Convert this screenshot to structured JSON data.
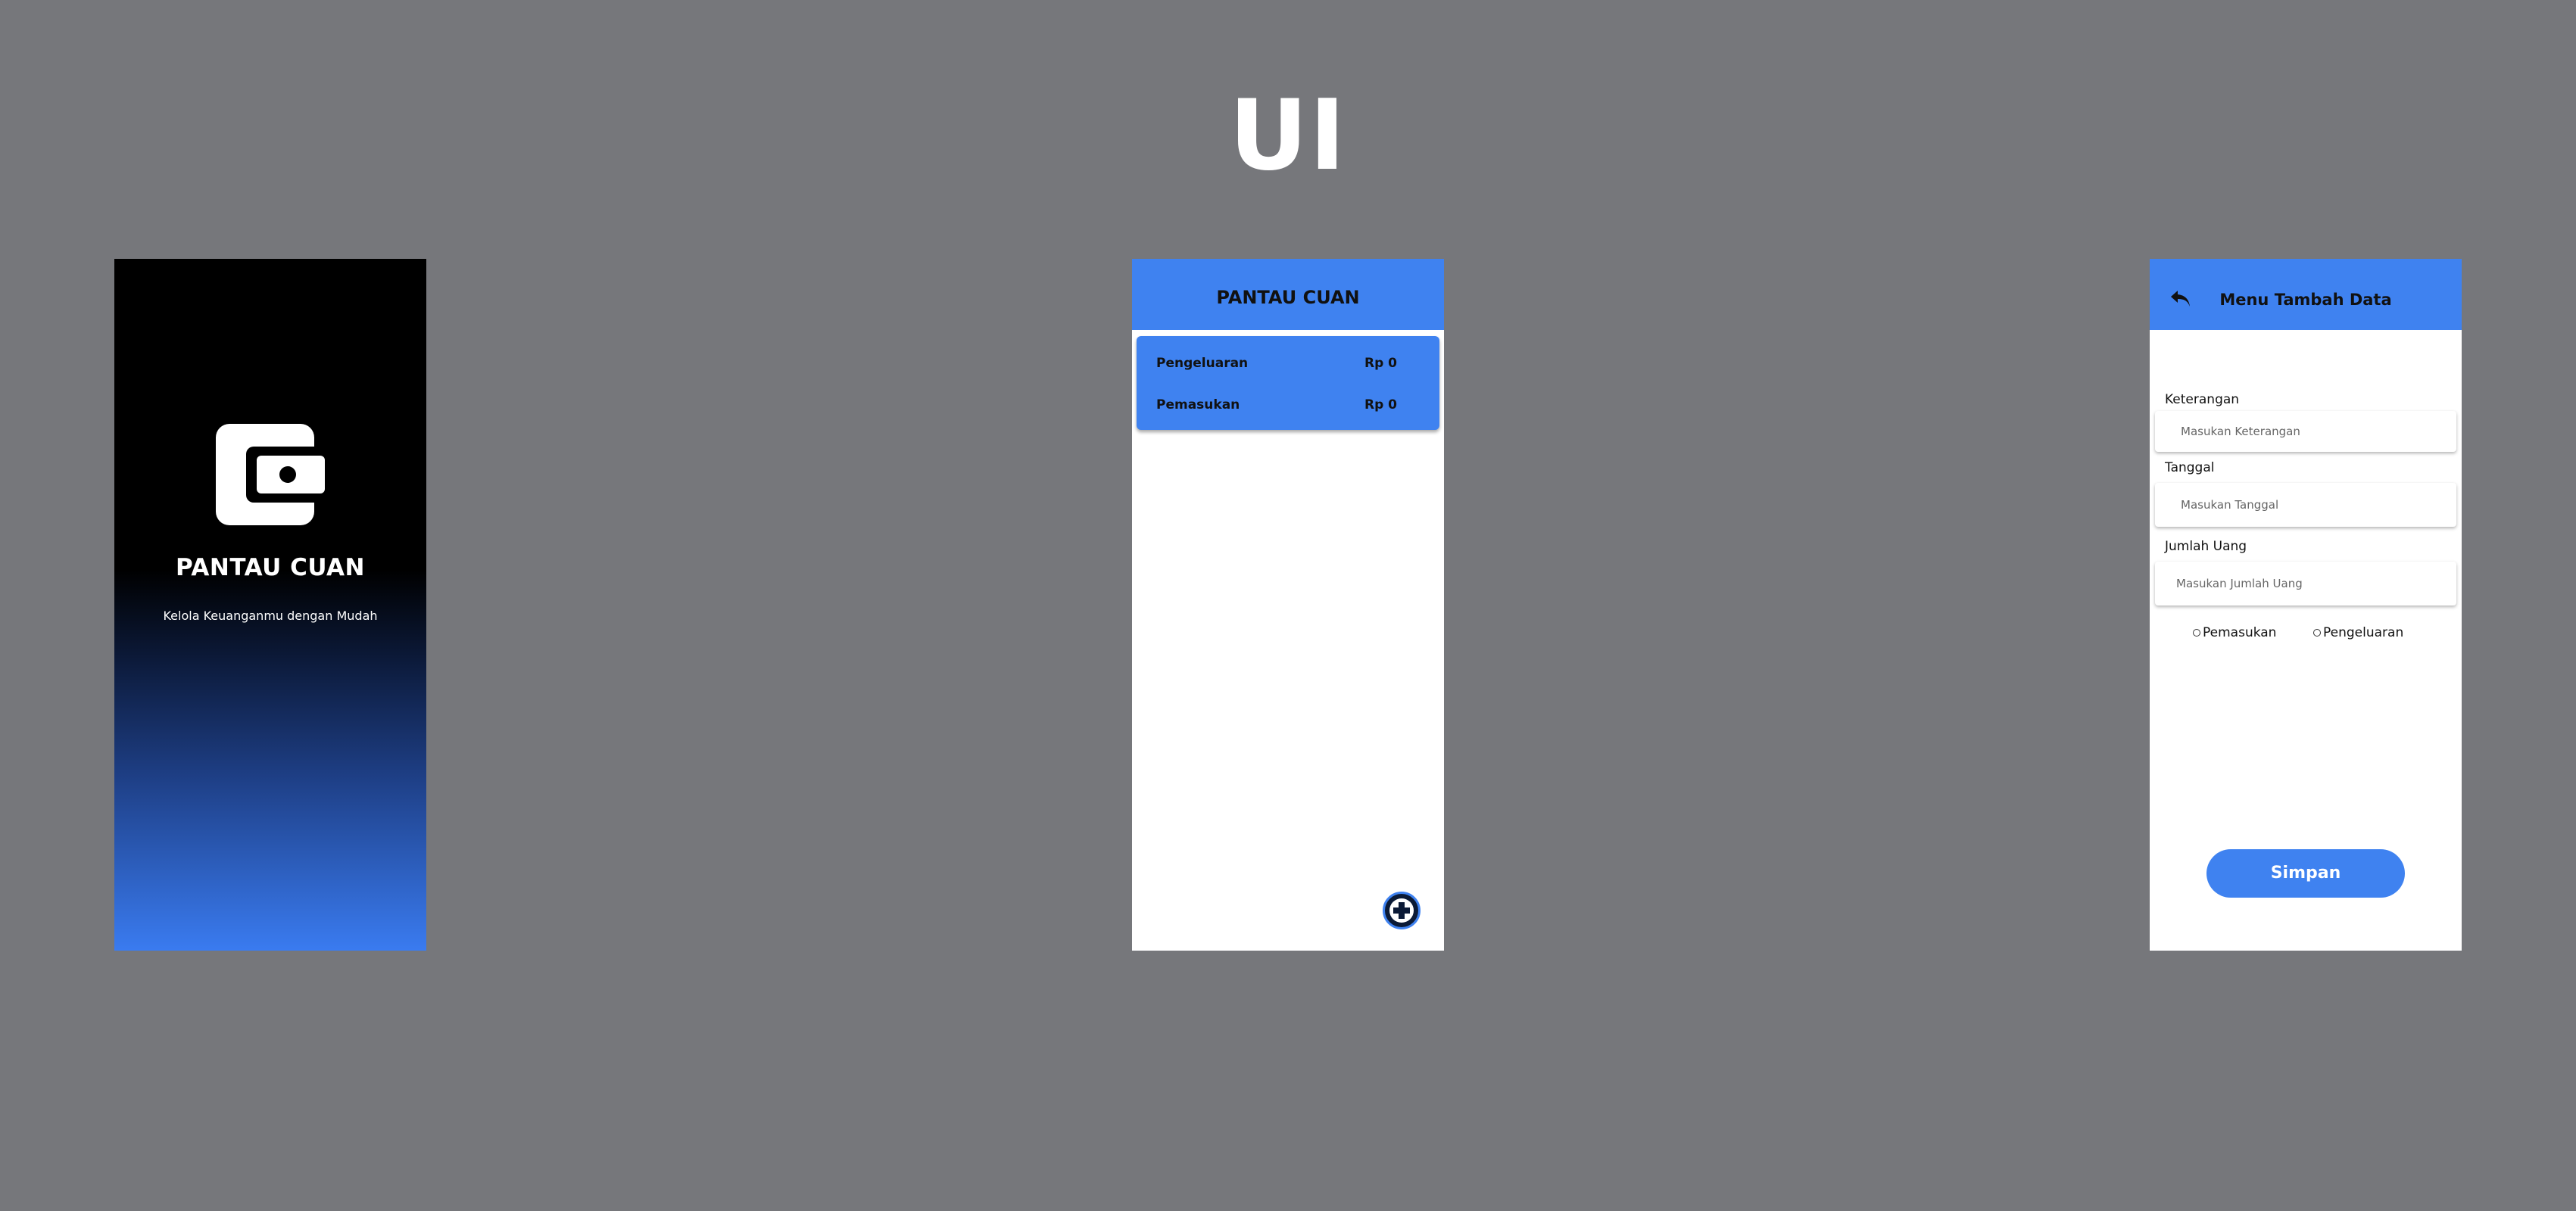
{
  "page": {
    "title": "UI"
  },
  "splash": {
    "icon": "wallet-icon",
    "app_name": "PANTAU CUAN",
    "tagline": "Kelola Keuanganmu dengan Mudah"
  },
  "home": {
    "title": "PANTAU CUAN",
    "summary": [
      {
        "label": "Pengeluaran",
        "value": "Rp 0"
      },
      {
        "label": "Pemasukan",
        "value": "Rp 0"
      }
    ],
    "fab_icon": "plus-circle-icon"
  },
  "add_data": {
    "back_icon": "back-arrow-icon",
    "title": "Menu Tambah Data",
    "fields": [
      {
        "label": "Keterangan",
        "placeholder": "Masukan Keterangan"
      },
      {
        "label": "Tanggal",
        "placeholder": "Masukan Tanggal"
      },
      {
        "label": "Jumlah Uang",
        "placeholder": "Masukan Jumlah Uang"
      }
    ],
    "radio_options": [
      "Pemasukan",
      "Pengeluaran"
    ],
    "save_label": "Simpan"
  },
  "colors": {
    "background": "#76777b",
    "accent": "#3f82f0",
    "dark": "#000000"
  }
}
